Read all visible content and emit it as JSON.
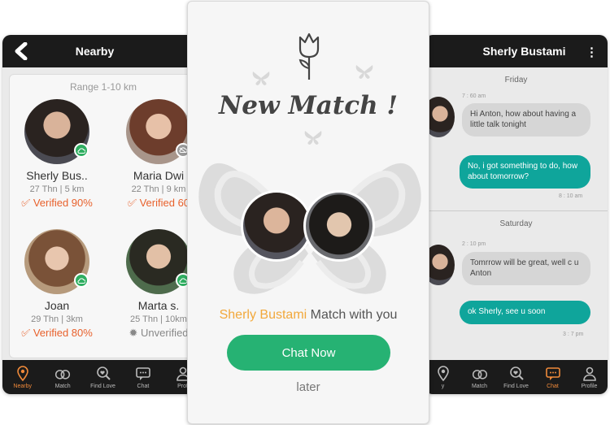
{
  "left_screen": {
    "title": "Nearby",
    "range": "Range 1-10 km",
    "profiles": [
      {
        "name": "Sherly Bus..",
        "info": "27 Thn | 5 km",
        "verified": "Verified 90%",
        "status_color": "#2fae61"
      },
      {
        "name": "Maria Dwi",
        "info": "22 Thn | 9 km",
        "verified": "Verified 60",
        "status_color": "#999999"
      },
      {
        "name": "Joan",
        "info": "29 Thn | 3km",
        "verified": "Verified 80%",
        "status_color": "#2fae61"
      },
      {
        "name": "Marta s.",
        "info": "25 Thn | 10km",
        "verified": "Unverified",
        "status_color": "#2fae61"
      }
    ],
    "nav": [
      {
        "label": "Nearby",
        "icon": "location-pin-icon"
      },
      {
        "label": "Match",
        "icon": "rings-icon"
      },
      {
        "label": "Find Love",
        "icon": "heart-search-icon"
      },
      {
        "label": "Chat",
        "icon": "chat-icon"
      },
      {
        "label": "Profi",
        "icon": "user-icon"
      }
    ]
  },
  "center_modal": {
    "title": "New Match !",
    "match_name": "Sherly Bustami",
    "match_suffix": "Match with you",
    "chat_button": "Chat Now",
    "later": "later"
  },
  "right_screen": {
    "title": "Sherly Bustami",
    "menu_icon": "more-vertical-icon",
    "days": [
      "Friday",
      "Saturday"
    ],
    "messages": [
      {
        "time": "7 : 60 am",
        "text": "Hi Anton, how about having a little talk tonight",
        "direction": "in"
      },
      {
        "time": "8 : 10 am",
        "text": "No, i got something to do, how about tomorrow?",
        "direction": "out"
      },
      {
        "time": "2 : 10 pm",
        "text": "Tomrrow will be great, well c u Anton",
        "direction": "in"
      },
      {
        "time": "3 : 7 pm",
        "text": "ok  Sherly, see u soon",
        "direction": "out"
      }
    ],
    "nav": [
      {
        "label": "y",
        "icon": "location-pin-icon"
      },
      {
        "label": "Match",
        "icon": "rings-icon"
      },
      {
        "label": "Find Love",
        "icon": "heart-search-icon"
      },
      {
        "label": "Chat",
        "icon": "chat-icon"
      },
      {
        "label": "Profile",
        "icon": "user-icon"
      }
    ]
  },
  "colors": {
    "accent": "#e8612c",
    "chat_green": "#26b273",
    "bubble_out": "#0fa59b",
    "name_highlight": "#f2a83b",
    "bar": "#1b1b1b"
  }
}
